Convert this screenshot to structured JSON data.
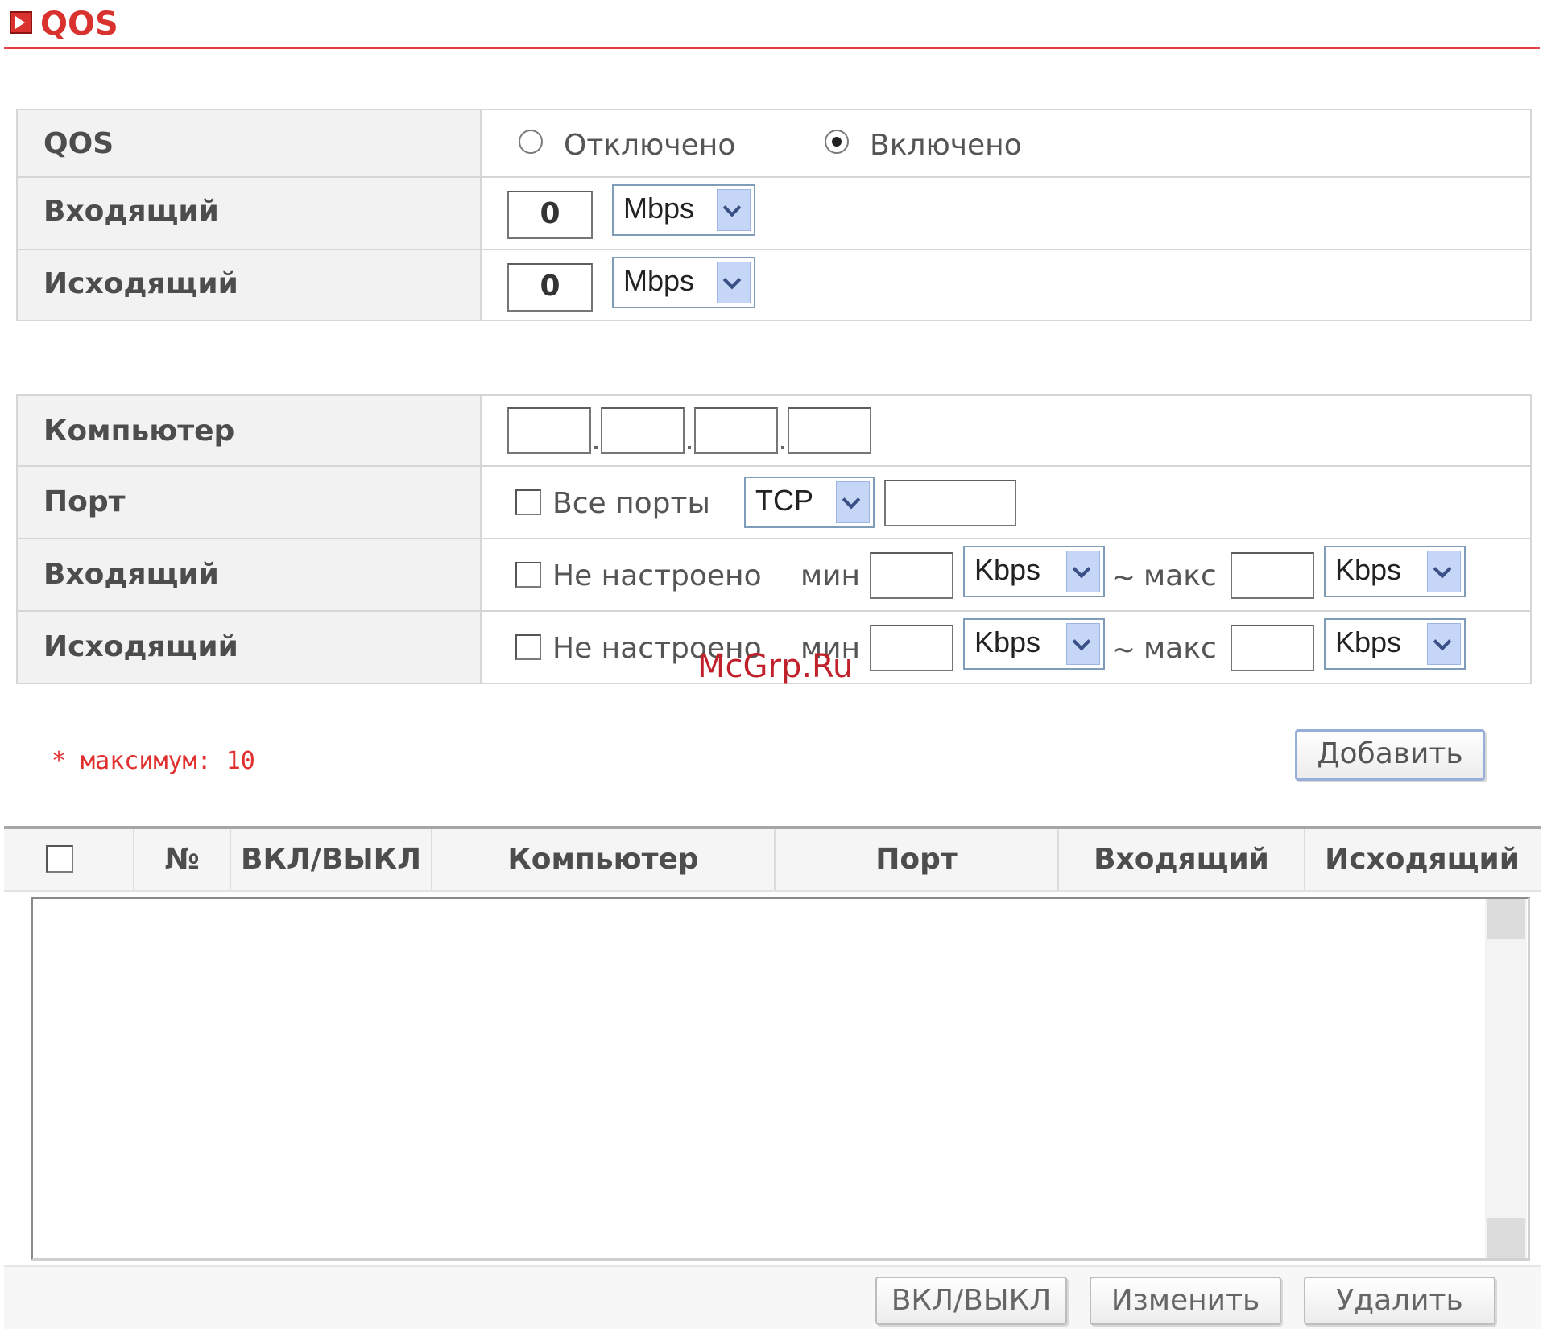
{
  "header": {
    "title": "QOS"
  },
  "general": {
    "qos_label": "QOS",
    "options": [
      "Отключено",
      "Включено"
    ],
    "selected_option": "Включено",
    "incoming": {
      "label": "Входящий",
      "value": "0",
      "unit": "Mbps"
    },
    "outgoing": {
      "label": "Исходящий",
      "value": "0",
      "unit": "Mbps"
    }
  },
  "rule": {
    "computer_label": "Компьютер",
    "computer_ip": [
      "",
      "",
      "",
      ""
    ],
    "port": {
      "label": "Порт",
      "all_ports_label": "Все порты",
      "protocol": "TCP",
      "port_value": ""
    },
    "incoming": {
      "label": "Входящий",
      "not_set_label": "Не настроено",
      "min_label": "мин",
      "min_unit": "Kbps",
      "tilde": "~",
      "max_label": "макс",
      "max_unit": "Kbps"
    },
    "outgoing": {
      "label": "Исходящий",
      "not_set_label": "Не настроено",
      "min_label": "мин",
      "min_unit": "Kbps",
      "tilde": "~",
      "max_label": "макс",
      "max_unit": "Kbps"
    }
  },
  "note": "* максимум: 10",
  "add_button": "Добавить",
  "list": {
    "columns": [
      "№",
      "ВКЛ/ВЫКЛ",
      "Компьютер",
      "Порт",
      "Входящий",
      "Исходящий"
    ],
    "rows": []
  },
  "actions": {
    "toggle": "ВКЛ/ВЫКЛ",
    "edit": "Изменить",
    "delete": "Удалить"
  },
  "watermark": "McGrp.Ru",
  "colors": {
    "accent": "#d9322e",
    "note": "#e03030",
    "select_border": "#7f9db9",
    "select_arrow": "#c5d6f7"
  }
}
